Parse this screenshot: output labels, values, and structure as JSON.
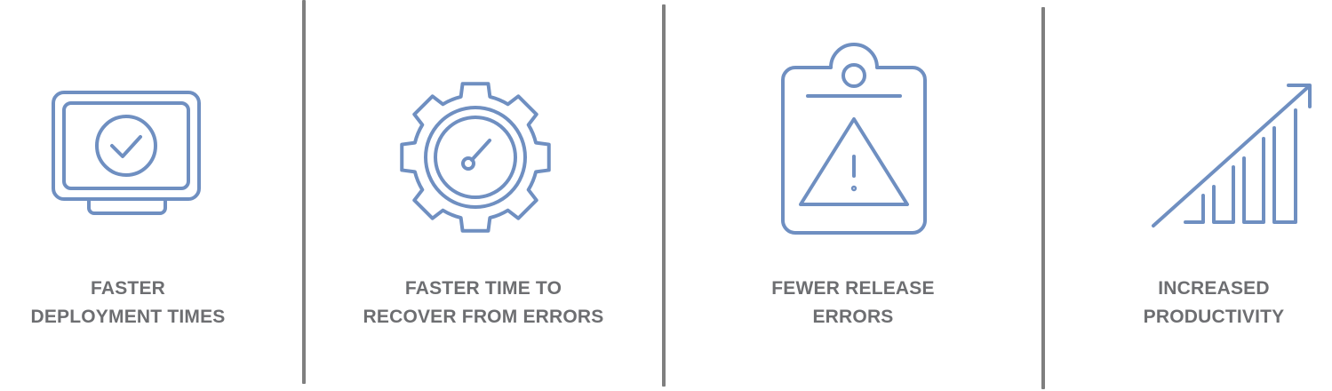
{
  "colors": {
    "icon": "#6f8fc1",
    "text": "#6d6e71",
    "divider": "#7f7f7f",
    "background": "#ffffff"
  },
  "benefits": [
    {
      "icon": "monitor-check-icon",
      "line1": "FASTER",
      "line2": "DEPLOYMENT TIMES"
    },
    {
      "icon": "gear-gauge-icon",
      "line1": "FASTER TIME TO",
      "line2": "RECOVER FROM ERRORS"
    },
    {
      "icon": "clipboard-warning-icon",
      "line1": "FEWER RELEASE",
      "line2": "ERRORS"
    },
    {
      "icon": "growth-chart-icon",
      "line1": "INCREASED",
      "line2": "PRODUCTIVITY"
    }
  ]
}
